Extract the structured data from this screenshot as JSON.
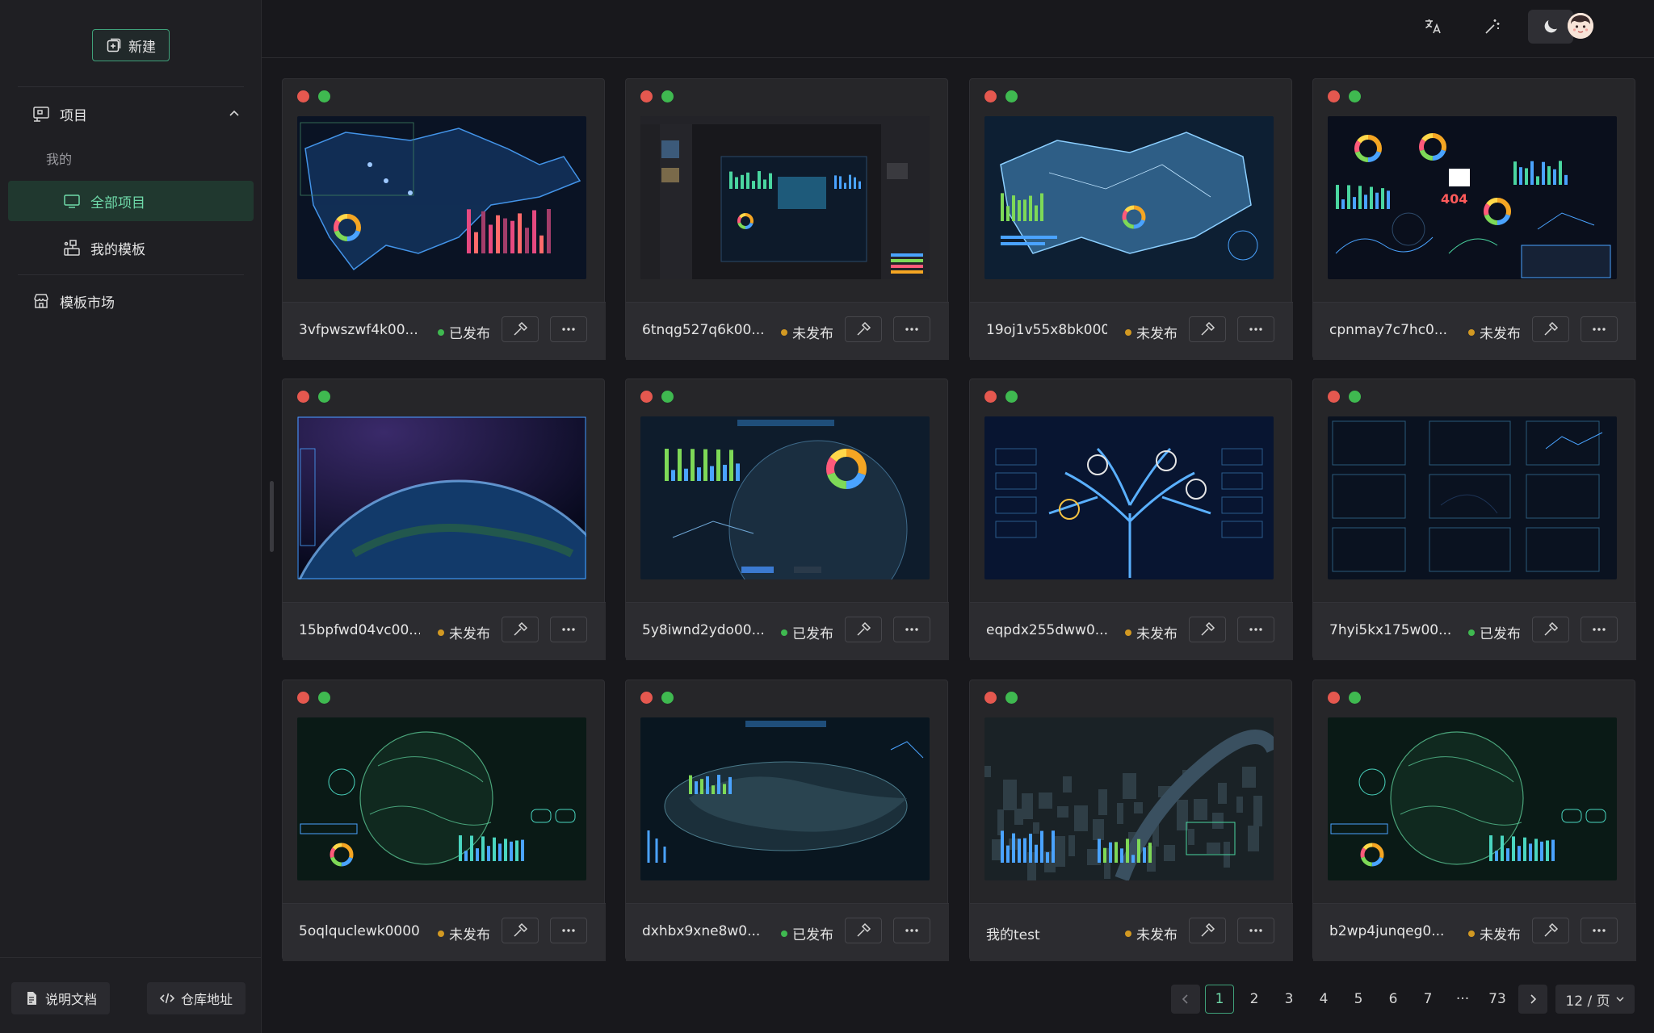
{
  "sidebar": {
    "new_label": "新建",
    "group_label": "项目",
    "sub_label": "我的",
    "items": [
      {
        "label": "全部项目",
        "icon": "monitor-icon"
      },
      {
        "label": "我的模板",
        "icon": "template-icon"
      }
    ],
    "market_label": "模板市场",
    "docs_label": "说明文档",
    "repo_label": "仓库地址"
  },
  "header": {
    "icons": [
      "translate-icon",
      "magic-wand-icon",
      "moon-icon"
    ],
    "avatar": "user-avatar"
  },
  "cards": [
    {
      "name": "3vfpwszwf4k00...",
      "status": "已发布",
      "published": true,
      "theme": "map"
    },
    {
      "name": "6tnqg527q6k00...",
      "status": "未发布",
      "published": false,
      "theme": "editor"
    },
    {
      "name": "19oj1v55x8bk000",
      "status": "未发布",
      "published": false,
      "theme": "map3d"
    },
    {
      "name": "cpnmay7c7hc0...",
      "status": "未发布",
      "published": false,
      "theme": "charts"
    },
    {
      "name": "15bpfwd04vc00...",
      "status": "未发布",
      "published": false,
      "theme": "earth"
    },
    {
      "name": "5y8iwnd2ydo00...",
      "status": "已发布",
      "published": true,
      "theme": "globe"
    },
    {
      "name": "eqpdx255dww0...",
      "status": "未发布",
      "published": false,
      "theme": "tree"
    },
    {
      "name": "7hyi5kx175w00...",
      "status": "已发布",
      "published": true,
      "theme": "grid"
    },
    {
      "name": "5oqlquclewk0000",
      "status": "未发布",
      "published": false,
      "theme": "world"
    },
    {
      "name": "dxhbx9xne8w0...",
      "status": "已发布",
      "published": true,
      "theme": "island"
    },
    {
      "name": "我的test",
      "status": "未发布",
      "published": false,
      "theme": "city"
    },
    {
      "name": "b2wp4junqeg0...",
      "status": "未发布",
      "published": false,
      "theme": "world"
    }
  ],
  "pagination": {
    "pages": [
      "1",
      "2",
      "3",
      "4",
      "5",
      "6",
      "7",
      "···",
      "73"
    ],
    "current": "1",
    "page_size": "12 / 页"
  },
  "colors": {
    "accent": "#3fa17a",
    "published_dot": "#3fb950",
    "unpublished_dot": "#d29922"
  }
}
